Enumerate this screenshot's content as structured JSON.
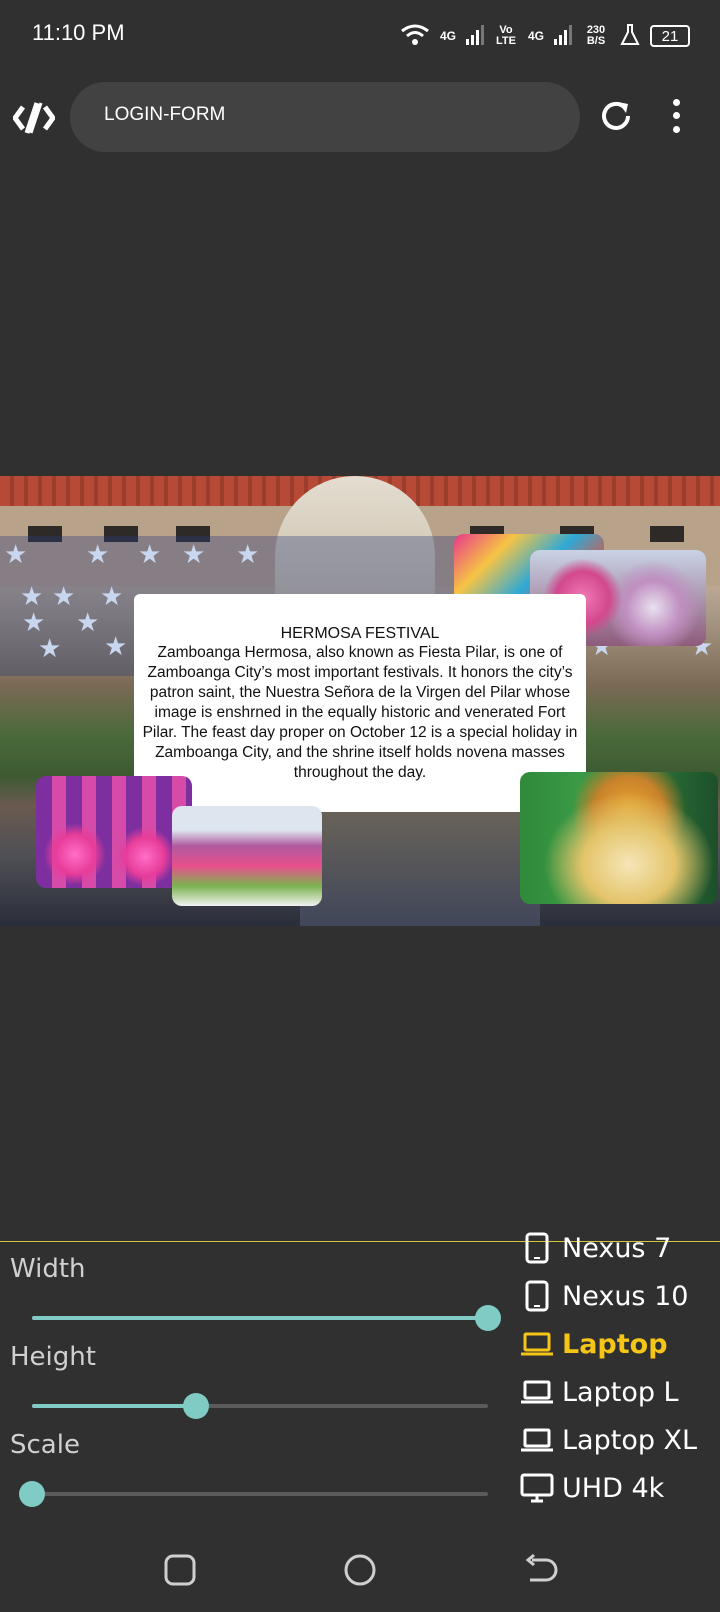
{
  "status_bar": {
    "time": "11:10 PM",
    "network_1": "4G",
    "volte": "Vo LTE",
    "network_2": "4G",
    "speed": "230 B/S",
    "battery": "21",
    "icons": [
      "wifi-icon",
      "signal-icon",
      "signal-icon",
      "flask-icon",
      "battery-icon"
    ]
  },
  "toolbar": {
    "logo_icon": "code-logo-icon",
    "url_text": "LOGIN-FORM",
    "reload_icon": "reload-icon",
    "menu_icon": "more-vert-icon"
  },
  "preview": {
    "title": "HERMOSA FESTIVAL",
    "body": "Zamboanga Hermosa, also known as Fiesta Pilar, is one of Zamboanga City’s most important festivals. It honors the city’s patron saint, the Nuestra Señora de la Virgen del Pilar whose image is enshrned in the equally historic and venerated Fort Pilar. The feast day proper on October 12 is a special holiday in Zamboanga City, and the shrine itself holds novena masses throughout the day."
  },
  "controls": {
    "width_label": "Width",
    "height_label": "Height",
    "scale_label": "Scale",
    "width_value": 1.0,
    "height_value": 0.36,
    "scale_value": 0.0,
    "accent": "#80cbc4"
  },
  "devices": [
    {
      "label": "Nexus 7",
      "icon": "tablet-icon",
      "active": false
    },
    {
      "label": "Nexus 10",
      "icon": "tablet-icon",
      "active": false
    },
    {
      "label": "Laptop",
      "icon": "laptop-icon",
      "active": true
    },
    {
      "label": "Laptop L",
      "icon": "laptop-icon",
      "active": false
    },
    {
      "label": "Laptop XL",
      "icon": "laptop-icon",
      "active": false
    },
    {
      "label": "UHD 4k",
      "icon": "monitor-icon",
      "active": false
    }
  ],
  "active_color": "#f5c518",
  "nav_bar": {
    "icons": [
      "recents-icon",
      "home-icon",
      "back-icon"
    ]
  }
}
